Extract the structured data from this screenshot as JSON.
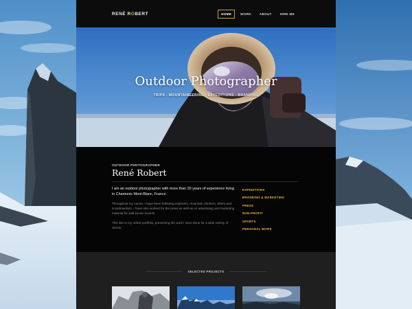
{
  "nav": {
    "brand_first": "RENÉ R",
    "brand_accent": "O",
    "brand_rest": "BERT",
    "items": [
      {
        "label": "HOME",
        "active": true
      },
      {
        "label": "WORK",
        "active": false
      },
      {
        "label": "ABOUT",
        "active": false
      },
      {
        "label": "HIRE ME",
        "active": false
      }
    ]
  },
  "hero": {
    "title": "Outdoor Photographer",
    "subtitle": "TRIPS - MOUNTAINEERING - EXPEDITIONS - BRANDING"
  },
  "intro": {
    "kicker": "OUTDOOR PHOTOGRAPHER",
    "name": "René Robert",
    "lead": "I am an outdoor photographer with more than 20 years of experience living in Chamonix Mont-Blanc, France.",
    "body_1": "Throughout my career, I have been following explorers, mountain climbers, skiers and snowboarders. I have also worked for the press as well as on advertising and marketing material for well known brands.",
    "body_2": "This site is my online portfolio, presenting the work I have done for a wide variety of clients.",
    "categories": [
      "EXPEDITIONS",
      "BRANDING & MARKETING",
      "PRESS",
      "NON-PROFIT",
      "SPORTS",
      "PERSONAL WORK"
    ]
  },
  "projects": {
    "heading": "SELECTED PROJECTS"
  },
  "colors": {
    "accent": "#e0b43a",
    "page_bg": "#0a0a0a",
    "projects_bg": "#1f1f1f"
  }
}
